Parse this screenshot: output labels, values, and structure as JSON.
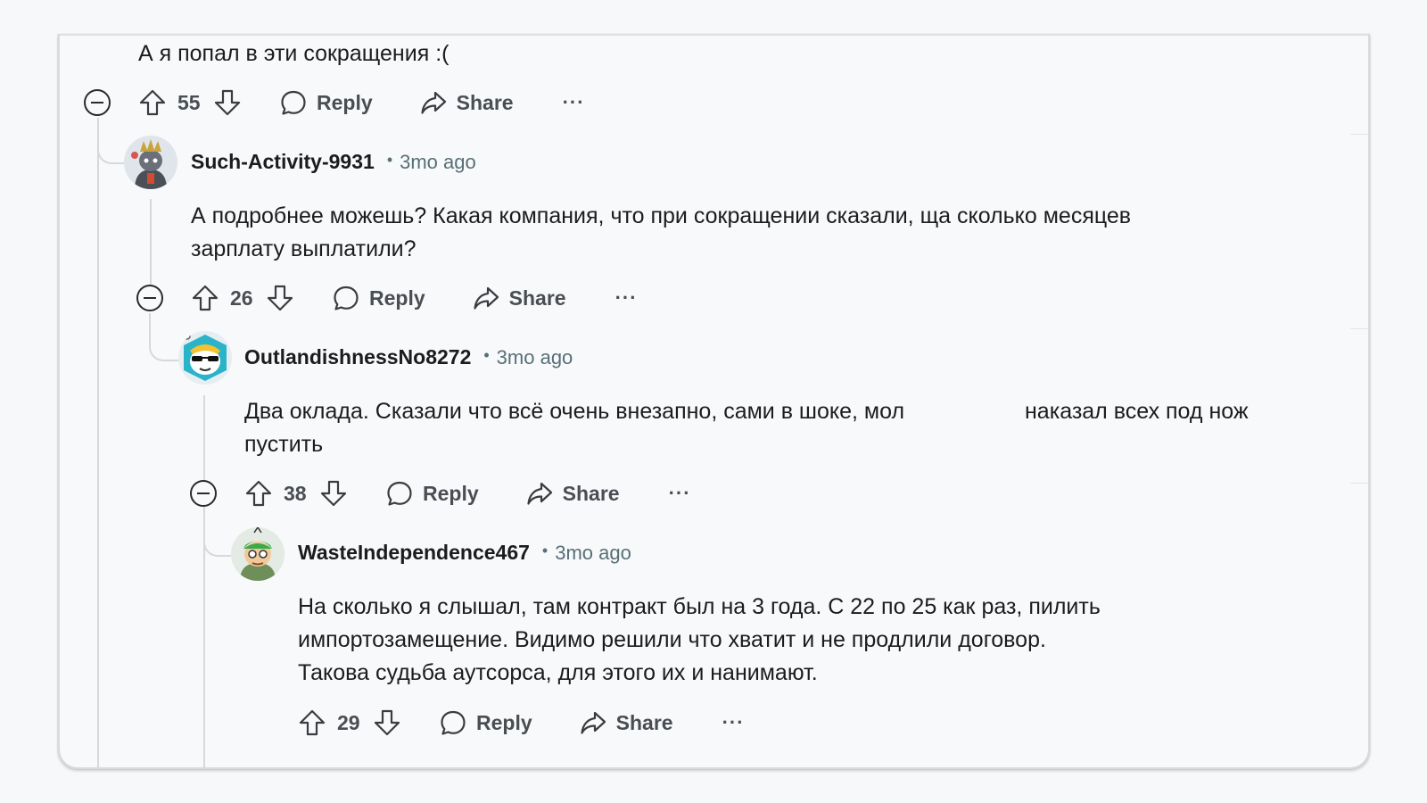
{
  "top_comment": {
    "text": "А я попал в эти сокращения :(",
    "score": "55",
    "reply_label": "Reply",
    "share_label": "Share",
    "more_label": "···"
  },
  "comments": [
    {
      "username": "Such-Activity-9931",
      "time": "3mo ago",
      "line1": "А подробнее можешь? Какая компания, что при сокращении сказали, ща сколько месяцев",
      "line2": "зарплату выплатили?",
      "score": "26",
      "reply_label": "Reply",
      "share_label": "Share",
      "more_label": "···"
    },
    {
      "username": "OutlandishnessNo8272",
      "time": "3mo ago",
      "line1a": "Два оклада. Сказали что всё очень внезапно, сами в шоке, мол",
      "line1b": "наказал всех под нож",
      "line2": "пустить",
      "score": "38",
      "reply_label": "Reply",
      "share_label": "Share",
      "more_label": "···"
    },
    {
      "username": "WasteIndependence467",
      "time": "3mo ago",
      "line1": "На сколько я слышал, там контракт был на 3 года. С 22 по 25 как раз, пилить",
      "line2": "импортозамещение. Видимо решили что хватит и не продлили договор.",
      "line3": "Такова судьба аутсорса, для этого их и нанимают.",
      "score": "29",
      "reply_label": "Reply",
      "share_label": "Share",
      "more_label": "···"
    }
  ],
  "separator_dot": "•",
  "icons": [
    "collapse-icon",
    "upvote-icon",
    "downvote-icon",
    "reply-bubble-icon",
    "share-arrow-icon",
    "more-options-icon"
  ],
  "colors": {
    "background": "#f8f9fb",
    "text": "#1c1c1c",
    "meta": "#576f76",
    "action": "#4a4e52",
    "thread_line": "#d6d9dc"
  }
}
